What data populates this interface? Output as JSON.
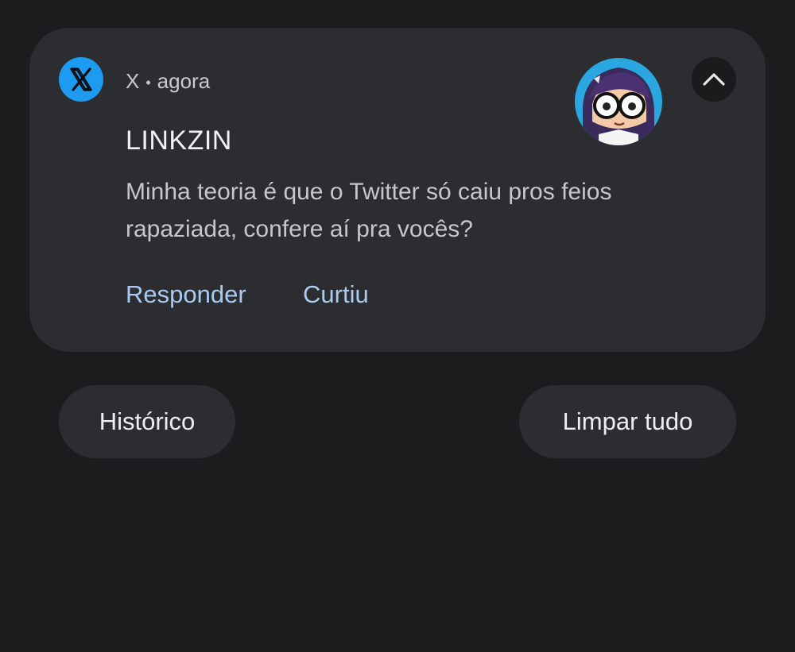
{
  "notification": {
    "app_name": "X",
    "separator": "•",
    "time": "agora",
    "title": "LINKZIN",
    "body": "Minha teoria é que o Twitter só caiu pros feios rapaziada, confere aí pra vocês?",
    "app_icon": "x-logo-icon",
    "collapse_icon": "chevron-up-icon",
    "actions": [
      {
        "label": "Responder"
      },
      {
        "label": "Curtiu"
      }
    ]
  },
  "footer": {
    "history_label": "Histórico",
    "clear_label": "Limpar tudo"
  },
  "colors": {
    "background": "#1b1c1e",
    "card": "#2b2d30",
    "accent": "#1d9bf0",
    "action_text": "#a9cbf2"
  }
}
